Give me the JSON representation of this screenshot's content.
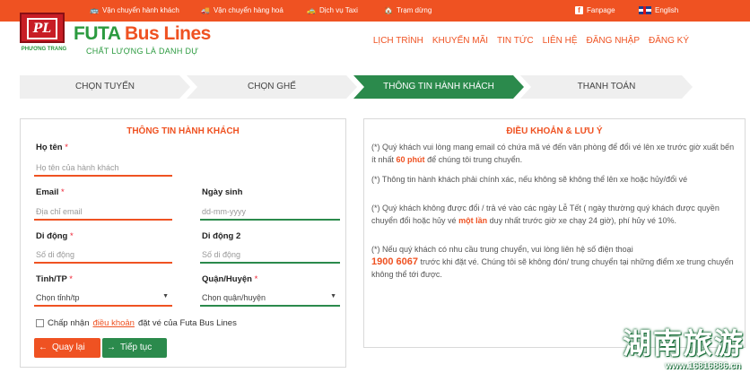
{
  "topbar": {
    "items": [
      {
        "icon": "bus-icon",
        "label": "Vận chuyển hành khách"
      },
      {
        "icon": "truck-icon",
        "label": "Vận chuyển hàng hoá"
      },
      {
        "icon": "car-icon",
        "label": "Dịch vụ Taxi"
      },
      {
        "icon": "station-icon",
        "label": "Trạm dừng"
      }
    ],
    "fanpage": "Fanpage",
    "language": "English"
  },
  "header": {
    "logo_text": "PL",
    "logo_sub": "PHƯƠNG TRANG",
    "brand_prefix": "FUTA",
    "brand_suffix": " Bus Lines",
    "tagline": "CHẤT LƯỢNG LÀ DANH DỰ",
    "nav": [
      "LỊCH TRÌNH",
      "KHUYẾN MÃI",
      "TIN TỨC",
      "LIÊN HỆ",
      "ĐĂNG NHẬP",
      "ĐĂNG KÝ"
    ]
  },
  "steps": [
    "CHỌN TUYẾN",
    "CHỌN GHẾ",
    "THÔNG TIN HÀNH KHÁCH",
    "THANH TOÁN"
  ],
  "active_step": 2,
  "form": {
    "title": "THÔNG TIN HÀNH KHÁCH",
    "name_label": "Họ tên",
    "name_placeholder": "Họ tên của hành khách",
    "email_label": "Email",
    "email_placeholder": "Địa chỉ email",
    "dob_label": "Ngày sinh",
    "dob_placeholder": "dd-mm-yyyy",
    "phone_label": "Di động",
    "phone_placeholder": "Số di động",
    "phone2_label": "Di động 2",
    "phone2_placeholder": "Số di động",
    "province_label": "Tỉnh/TP",
    "province_value": "Chọn tỉnh/tp",
    "district_label": "Quận/Huyện",
    "district_value": "Chọn quận/huyện",
    "required_mark": "*",
    "accept_prefix": "Chấp nhận",
    "accept_link": "điều khoản",
    "accept_suffix": "đặt vé của Futa Bus Lines",
    "back_label": "Quay lại",
    "next_label": "Tiếp tục"
  },
  "terms": {
    "title": "ĐIỀU KHOẢN & LƯU Ý",
    "t1a": "(*) Quý khách vui lòng mang email có chứa mã vé đến văn phòng để đổi vé lên xe trước giờ xuất bến ít nhất",
    "t1b": "60 phút",
    "t1c": "để chúng tôi trung chuyển.",
    "t2": "(*) Thông tin hành khách phải chính xác, nếu không sẽ không thể lên xe hoặc hủy/đổi vé",
    "t3a": "(*) Quý khách không được đổi / trả vé vào các ngày Lễ Tết ( ngày thường quý khách được quyền chuyển đổi hoặc hủy vé",
    "t3b": "một lần",
    "t3c": "duy nhất trước giờ xe chạy 24 giờ), phí hủy vé 10%.",
    "t4a": "(*) Nếu quý khách có nhu cầu trung chuyển, vui lòng liên hệ số điện thoại",
    "t4b": "1900 6067",
    "t4c": "trước khi đặt vé. Chúng tôi sẽ không đón/ trung chuyển tại những điểm xe trung chuyển không thể tới được."
  },
  "watermark": {
    "text": "湖南旅游",
    "url": "www.16816886.cn"
  },
  "colors": {
    "accent": "#ef5222",
    "green": "#2b8a4c"
  }
}
